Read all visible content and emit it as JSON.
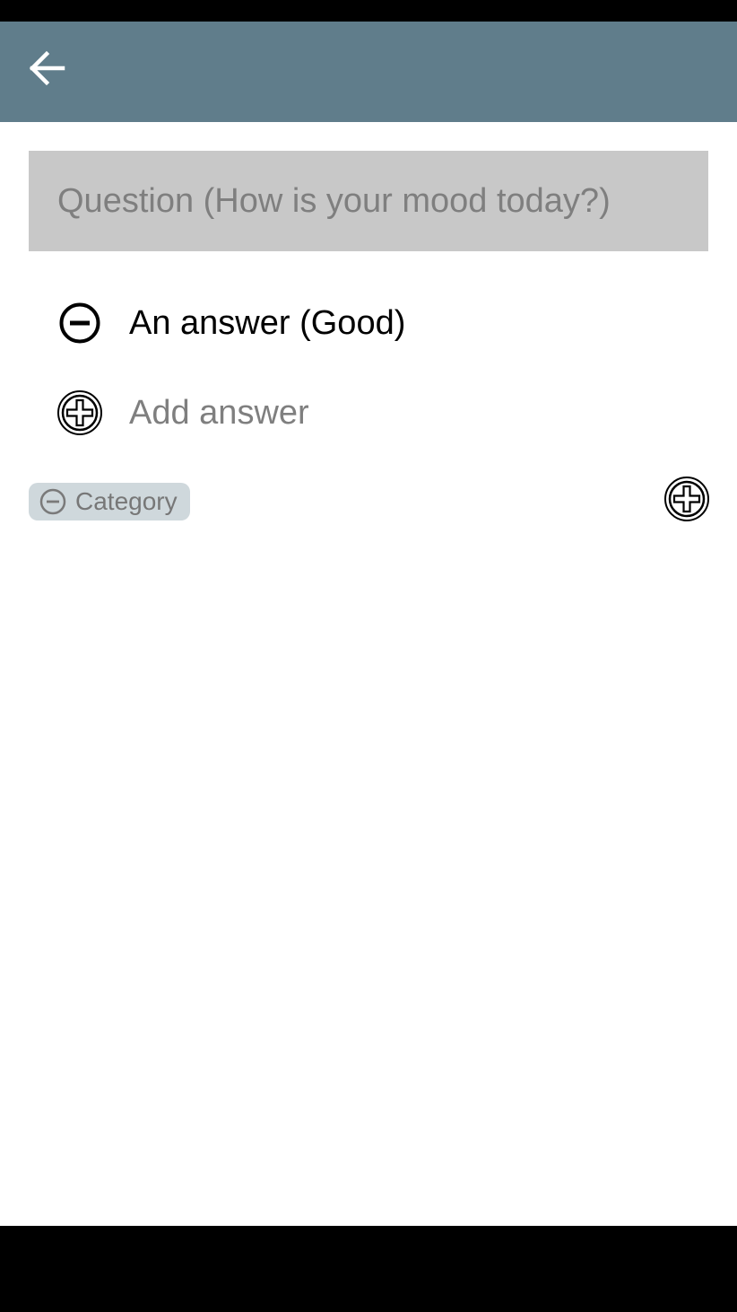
{
  "colors": {
    "app_bar": "#607d8b",
    "question_field_bg": "#c8c8c8",
    "chip_bg": "#cfd8dc",
    "hint_text": "#7f7f7f",
    "icon_white": "#ffffff",
    "icon_black": "#000000"
  },
  "app_bar": {
    "back_icon": "arrow-left-icon"
  },
  "question": {
    "value": "",
    "placeholder": "Question (How is your mood today?)"
  },
  "answers": [
    {
      "label": "An answer (Good)",
      "icon": "minus-circle-icon"
    }
  ],
  "add_answer": {
    "value": "",
    "placeholder": "Add answer",
    "icon": "plus-circle-icon"
  },
  "category": {
    "chip_label": "Category",
    "chip_icon": "minus-circle-icon",
    "add_icon": "plus-circle-icon"
  }
}
